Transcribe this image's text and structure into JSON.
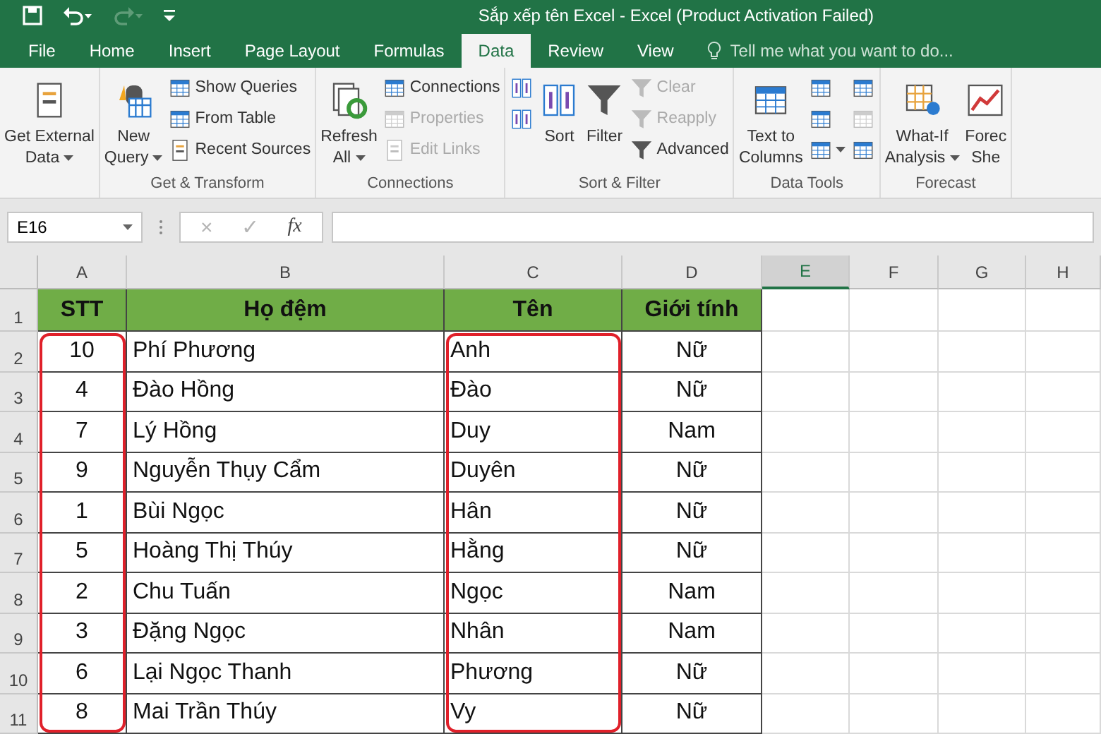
{
  "window": {
    "title": "Sắp xếp tên Excel - Excel (Product Activation Failed)"
  },
  "tabs": [
    {
      "label": "File",
      "selected": false
    },
    {
      "label": "Home",
      "selected": false
    },
    {
      "label": "Insert",
      "selected": false
    },
    {
      "label": "Page Layout",
      "selected": false
    },
    {
      "label": "Formulas",
      "selected": false
    },
    {
      "label": "Data",
      "selected": true
    },
    {
      "label": "Review",
      "selected": false
    },
    {
      "label": "View",
      "selected": false
    }
  ],
  "tell_me": {
    "placeholder": "Tell me what you want to do..."
  },
  "ribbon": {
    "groups": [
      {
        "columns": [
          {
            "kind": "large",
            "buttons": [
              {
                "lines": [
                  "Get External",
                  "Data"
                ],
                "dropdown": true,
                "disabled": false
              }
            ]
          }
        ]
      },
      {
        "label": "Get & Transform",
        "columns": [
          {
            "kind": "large",
            "buttons": [
              {
                "lines": [
                  "New",
                  "Query"
                ],
                "dropdown": true,
                "disabled": false
              }
            ]
          },
          {
            "kind": "small",
            "buttons": [
              {
                "label": "Show Queries",
                "dropdown": false,
                "disabled": false
              },
              {
                "label": "From Table",
                "dropdown": false,
                "disabled": false
              },
              {
                "label": "Recent Sources",
                "dropdown": false,
                "disabled": false
              }
            ]
          }
        ]
      },
      {
        "label": "Connections",
        "columns": [
          {
            "kind": "large",
            "buttons": [
              {
                "lines": [
                  "Refresh",
                  "All"
                ],
                "dropdown": true,
                "disabled": false
              }
            ]
          },
          {
            "kind": "small",
            "buttons": [
              {
                "label": "Connections",
                "dropdown": false,
                "disabled": false
              },
              {
                "label": "Properties",
                "dropdown": false,
                "disabled": true
              },
              {
                "label": "Edit Links",
                "dropdown": false,
                "disabled": true
              }
            ]
          }
        ]
      },
      {
        "label": "Sort & Filter",
        "columns": [
          {
            "kind": "small",
            "buttons": [
              {
                "dropdown": false,
                "disabled": false
              },
              {
                "dropdown": false,
                "disabled": false
              }
            ]
          },
          {
            "kind": "large",
            "buttons": [
              {
                "lines": [
                  "Sort"
                ],
                "dropdown": false,
                "disabled": false
              }
            ]
          },
          {
            "kind": "large",
            "buttons": [
              {
                "lines": [
                  "Filter"
                ],
                "dropdown": false,
                "disabled": false
              }
            ]
          },
          {
            "kind": "small",
            "buttons": [
              {
                "label": "Clear",
                "dropdown": false,
                "disabled": true
              },
              {
                "label": "Reapply",
                "dropdown": false,
                "disabled": true
              },
              {
                "label": "Advanced",
                "dropdown": false,
                "disabled": false
              }
            ]
          }
        ]
      },
      {
        "label": "Data Tools",
        "columns": [
          {
            "kind": "large",
            "buttons": [
              {
                "lines": [
                  "Text to",
                  "Columns"
                ],
                "dropdown": false,
                "disabled": false
              }
            ]
          },
          {
            "kind": "small",
            "buttons": [
              {
                "dropdown": false,
                "disabled": false
              },
              {
                "dropdown": false,
                "disabled": false
              },
              {
                "dropdown": true,
                "disabled": false
              }
            ]
          },
          {
            "kind": "small",
            "buttons": [
              {
                "dropdown": false,
                "disabled": false
              },
              {
                "dropdown": false,
                "disabled": true
              },
              {
                "dropdown": false,
                "disabled": false
              }
            ]
          }
        ]
      },
      {
        "label": "Forecast",
        "columns": [
          {
            "kind": "large",
            "buttons": [
              {
                "lines": [
                  "What-If",
                  "Analysis"
                ],
                "dropdown": true,
                "disabled": false
              }
            ]
          },
          {
            "kind": "large",
            "buttons": [
              {
                "lines": [
                  "Forec",
                  "She"
                ],
                "dropdown": false,
                "disabled": false
              }
            ]
          }
        ]
      }
    ]
  },
  "formula_bar": {
    "name_box": "E16",
    "buttons": [
      {
        "label": "×",
        "disabled": true
      },
      {
        "label": "✓",
        "disabled": true
      },
      {
        "label": "fx",
        "disabled": false
      }
    ]
  },
  "sheet": {
    "columns": [
      {
        "label": "A",
        "selected": false,
        "highlighted": true
      },
      {
        "label": "B",
        "selected": false,
        "highlighted": false
      },
      {
        "label": "C",
        "selected": false,
        "highlighted": true
      },
      {
        "label": "D",
        "selected": false,
        "highlighted": false
      },
      {
        "label": "E",
        "selected": true,
        "highlighted": false
      },
      {
        "label": "F",
        "selected": false,
        "highlighted": false
      },
      {
        "label": "G",
        "selected": false,
        "highlighted": false
      },
      {
        "label": "H",
        "selected": false,
        "highlighted": false
      }
    ],
    "header": [
      "STT",
      "Họ đệm",
      "Tên",
      "Giới tính"
    ],
    "rows": [
      {
        "number": "1"
      },
      {
        "number": "2",
        "cells": [
          "10",
          "Phí Phương",
          "Anh",
          "Nữ"
        ]
      },
      {
        "number": "3",
        "cells": [
          "4",
          "Đào Hồng",
          "Đào",
          "Nữ"
        ]
      },
      {
        "number": "4",
        "cells": [
          "7",
          "Lý Hồng",
          "Duy",
          "Nam"
        ]
      },
      {
        "number": "5",
        "cells": [
          "9",
          "Nguyễn Thụy Cẩm",
          "Duyên",
          "Nữ"
        ]
      },
      {
        "number": "6",
        "cells": [
          "1",
          "Bùi Ngọc",
          "Hân",
          "Nữ"
        ]
      },
      {
        "number": "7",
        "cells": [
          "5",
          "Hoàng Thị Thúy",
          "Hằng",
          "Nữ"
        ]
      },
      {
        "number": "8",
        "cells": [
          "2",
          "Chu Tuấn",
          "Ngọc",
          "Nam"
        ]
      },
      {
        "number": "9",
        "cells": [
          "3",
          "Đặng Ngọc",
          "Nhân",
          "Nam"
        ]
      },
      {
        "number": "10",
        "cells": [
          "6",
          "Lại Ngọc Thanh",
          "Phương",
          "Nữ"
        ]
      },
      {
        "number": "11",
        "cells": [
          "8",
          "Mai Trần Thúy",
          "Vy",
          "Nữ"
        ]
      }
    ]
  }
}
